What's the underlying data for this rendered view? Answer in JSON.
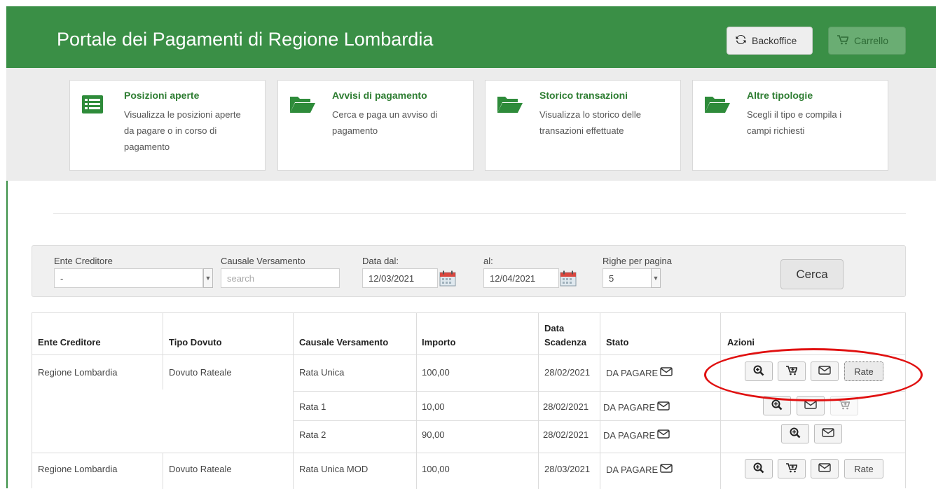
{
  "header": {
    "title": "Portale dei Pagamenti di Regione Lombardia",
    "backoffice_label": "Backoffice",
    "carrello_label": "Carrello"
  },
  "tiles": [
    {
      "title": "Posizioni aperte",
      "desc": "Visualizza le posizioni aperte da pagare o in corso di pagamento",
      "icon": "list-icon"
    },
    {
      "title": "Avvisi di pagamento",
      "desc": "Cerca e paga un avviso di pagamento",
      "icon": "folder-open-icon"
    },
    {
      "title": "Storico transazioni",
      "desc": "Visualizza lo storico delle transazioni effettuate",
      "icon": "folder-open-icon"
    },
    {
      "title": "Altre tipologie",
      "desc": "Scegli il tipo e compila i campi richiesti",
      "icon": "folder-open-icon"
    }
  ],
  "filters": {
    "ente_label": "Ente Creditore",
    "ente_value": "-",
    "causale_label": "Causale Versamento",
    "causale_placeholder": "search",
    "dal_label": "Data dal:",
    "dal_value": "12/03/2021",
    "al_label": "al:",
    "al_value": "12/04/2021",
    "righe_label": "Righe per pagina",
    "righe_value": "5",
    "cerca_label": "Cerca"
  },
  "table": {
    "headers": {
      "ente": "Ente Creditore",
      "tipo": "Tipo Dovuto",
      "causale": "Causale Versamento",
      "importo": "Importo",
      "data1": "Data",
      "data2": "Scadenza",
      "stato": "Stato",
      "azioni": "Azioni"
    },
    "rows": [
      {
        "ente": "Regione Lombardia",
        "tipo": "Dovuto Rateale",
        "causale": "Rata Unica",
        "importo": "100,00",
        "scadenza": "28/02/2021",
        "stato": "DA PAGARE",
        "rate_label": "Rate"
      },
      {
        "ente": "",
        "tipo": "",
        "causale": "Rata 1",
        "importo": "10,00",
        "scadenza": "28/02/2021",
        "stato": "DA PAGARE"
      },
      {
        "ente": "",
        "tipo": "",
        "causale": "Rata 2",
        "importo": "90,00",
        "scadenza": "28/02/2021",
        "stato": "DA PAGARE"
      },
      {
        "ente": "Regione Lombardia",
        "tipo": "Dovuto Rateale",
        "causale": "Rata Unica MOD",
        "importo": "100,00",
        "scadenza": "28/03/2021",
        "stato": "DA PAGARE",
        "rate_label": "Rate"
      }
    ]
  },
  "colors": {
    "header_green": "#3a8f46",
    "tile_title_green": "#2e7d32",
    "highlight_red": "#e01010"
  }
}
